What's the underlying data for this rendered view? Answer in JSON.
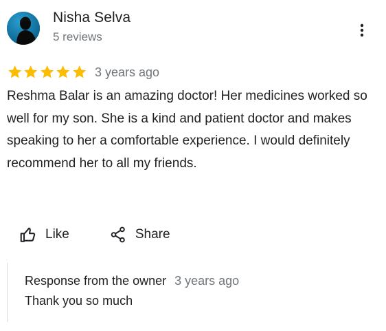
{
  "reviewer": {
    "name": "Nisha Selva",
    "review_count": "5 reviews",
    "avatar_icon": "person-silhouette-icon"
  },
  "menu": {
    "icon": "more-vert-icon"
  },
  "review": {
    "rating": 5,
    "rating_max": 5,
    "star_color": "#fbbc04",
    "date": "3 years ago",
    "text": "Reshma Balar is an amazing doctor! Her medicines worked so well for my son. She is a kind and patient doctor and makes speaking to her a comfortable experience. I would definitely recommend her to all my friends."
  },
  "actions": {
    "like_label": "Like",
    "like_icon": "thumbs-up-icon",
    "share_label": "Share",
    "share_icon": "share-icon"
  },
  "owner_response": {
    "title": "Response from the owner",
    "date": "3 years ago",
    "text": "Thank you so much"
  }
}
